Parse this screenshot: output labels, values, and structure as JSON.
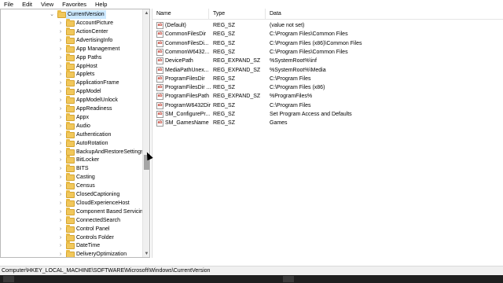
{
  "menu": [
    "File",
    "Edit",
    "View",
    "Favorites",
    "Help"
  ],
  "tree": {
    "selected_label": "CurrentVersion",
    "items": [
      "AccountPicture",
      "ActionCenter",
      "AdvertisingInfo",
      "App Management",
      "App Paths",
      "AppHost",
      "Applets",
      "ApplicationFrame",
      "AppModel",
      "AppModelUnlock",
      "AppReadiness",
      "Appx",
      "Audio",
      "Authentication",
      "AutoRotation",
      "BackupAndRestoreSettings",
      "BitLocker",
      "BITS",
      "Casting",
      "Census",
      "ClosedCaptioning",
      "CloudExperienceHost",
      "Component Based Servicing",
      "ConnectedSearch",
      "Control Panel",
      "Controls Folder",
      "DateTime",
      "DeliveryOptimization"
    ]
  },
  "list": {
    "columns": [
      "Name",
      "Type",
      "Data"
    ],
    "rows": [
      {
        "name": "(Default)",
        "type": "REG_SZ",
        "data": "(value not set)"
      },
      {
        "name": "CommonFilesDir",
        "type": "REG_SZ",
        "data": "C:\\Program Files\\Common Files"
      },
      {
        "name": "CommonFilesDi...",
        "type": "REG_SZ",
        "data": "C:\\Program Files (x86)\\Common Files"
      },
      {
        "name": "CommonW6432...",
        "type": "REG_SZ",
        "data": "C:\\Program Files\\Common Files"
      },
      {
        "name": "DevicePath",
        "type": "REG_EXPAND_SZ",
        "data": "%SystemRoot%\\inf"
      },
      {
        "name": "MediaPathUnex...",
        "type": "REG_EXPAND_SZ",
        "data": "%SystemRoot%\\Media"
      },
      {
        "name": "ProgramFilesDir",
        "type": "REG_SZ",
        "data": "C:\\Program Files"
      },
      {
        "name": "ProgramFilesDir ...",
        "type": "REG_SZ",
        "data": "C:\\Program Files (x86)"
      },
      {
        "name": "ProgramFilesPath",
        "type": "REG_EXPAND_SZ",
        "data": "%ProgramFiles%"
      },
      {
        "name": "ProgramW6432Dir",
        "type": "REG_SZ",
        "data": "C:\\Program Files"
      },
      {
        "name": "SM_ConfigurePr...",
        "type": "REG_SZ",
        "data": "Set Program Access and Defaults"
      },
      {
        "name": "SM_GamesName",
        "type": "REG_SZ",
        "data": "Games"
      }
    ]
  },
  "status": {
    "path": "Computer\\HKEY_LOCAL_MACHINE\\SOFTWARE\\Microsoft\\Windows\\CurrentVersion"
  },
  "icons": {
    "tree_folder": "folder-icon",
    "value_string": "string-value-icon",
    "expander": "chevron-right-icon"
  },
  "colors": {
    "selection": "#cce8ff",
    "folder": "#f1c75b",
    "taskbar": "#1f1f1f"
  }
}
